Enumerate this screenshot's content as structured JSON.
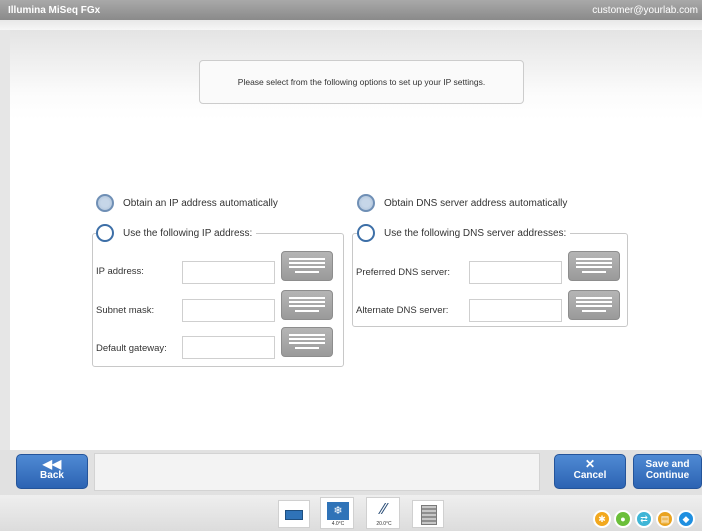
{
  "window": {
    "app_title": "Illumina MiSeq FGx",
    "user": "customer@yourlab.com"
  },
  "instruction": "Please select from the following options to set up your IP settings.",
  "ip": {
    "obtain_auto_label": "Obtain an IP address automatically",
    "obtain_auto_selected": true,
    "use_following_label": "Use the following IP address:",
    "use_following_selected": false,
    "fields": [
      {
        "label": "IP address:",
        "value": ""
      },
      {
        "label": "Subnet mask:",
        "value": ""
      },
      {
        "label": "Default gateway:",
        "value": ""
      }
    ]
  },
  "dns": {
    "obtain_auto_label": "Obtain DNS server address automatically",
    "obtain_auto_selected": true,
    "use_following_label": "Use the following DNS server addresses:",
    "use_following_selected": false,
    "fields": [
      {
        "label": "Preferred DNS server:",
        "value": ""
      },
      {
        "label": "Alternate DNS server:",
        "value": ""
      }
    ]
  },
  "toolbar": {
    "back_label": "Back",
    "cancel_label": "Cancel",
    "save_label_line1": "Save and",
    "save_label_line2": "Continue"
  },
  "footer": {
    "dock_temp1": "4.0°C",
    "dock_temp2": "20.0°C",
    "status_colors": [
      "#f2a81e",
      "#6bbf3a",
      "#3fb5d6",
      "#e9a320",
      "#1f8fe0"
    ]
  }
}
